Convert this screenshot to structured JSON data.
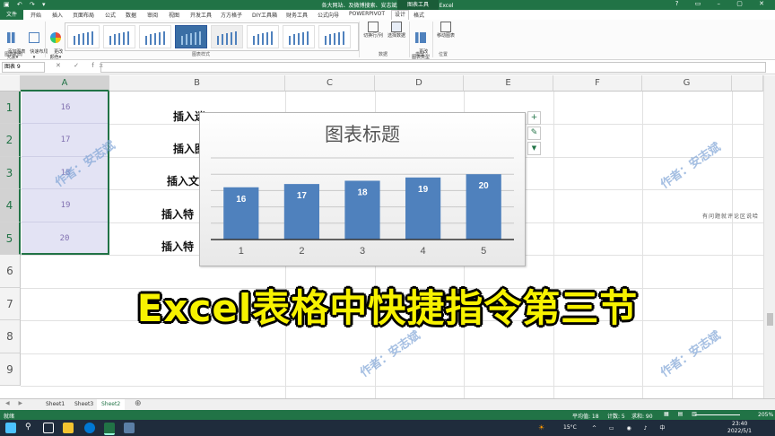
{
  "titlebar": {
    "title": "各大网站、及微博搜索、安志斌先生0018.xlsx - Excel",
    "context_tab": "图表工具"
  },
  "tabs": {
    "file": "文件",
    "items": [
      "开始",
      "插入",
      "页面布局",
      "公式",
      "数据",
      "审阅",
      "视图",
      "开发工具",
      "方方格子",
      "DIY工具箱",
      "财务工具",
      "公式向导",
      "POWERPIVOT",
      "设计",
      "格式"
    ]
  },
  "ribbon": {
    "add_element": "添加图表\n元素▾",
    "quick_layout": "快速布局\n▾",
    "change_colors": "更改\n颜色▾",
    "group_layout": "图表布局",
    "group_styles": "图表样式",
    "switch_row_col": "切换行/列",
    "select_data": "选择数据",
    "group_data": "数据",
    "change_type": "更改\n图表类型",
    "group_type": "类型",
    "move_chart": "移动图表",
    "group_location": "位置"
  },
  "formula_bar": {
    "name_box": "图表 9",
    "fx": "fx",
    "value": ""
  },
  "grid": {
    "columns": [
      "A",
      "B",
      "C",
      "D",
      "E",
      "F",
      "G"
    ],
    "rows": [
      "1",
      "2",
      "3",
      "4",
      "5",
      "6",
      "7",
      "8",
      "9"
    ],
    "col_a_values": [
      "16",
      "17",
      "18",
      "19",
      "20"
    ],
    "col_b_values": [
      "插入迷",
      "插入图",
      "插入文",
      "插入特",
      "插入特"
    ]
  },
  "chart_data": {
    "type": "bar",
    "title": "图表标题",
    "categories": [
      "1",
      "2",
      "3",
      "4",
      "5"
    ],
    "values": [
      16,
      17,
      18,
      19,
      20
    ],
    "ylim": [
      0,
      25
    ],
    "data_labels": [
      "16",
      "17",
      "18",
      "19",
      "20"
    ],
    "bar_color": "#4f81bd",
    "grid": true
  },
  "chart_buttons": {
    "elements": "+",
    "styles": "✎",
    "filter": "▼"
  },
  "watermarks": [
    "作者：安志斌",
    "作者：安志斌",
    "作者：安志斌",
    "作者：安志斌"
  ],
  "caption": "Excel表格中快捷指令第三节",
  "side_note": "有问题就评论区说哈",
  "sheets": [
    "Sheet1",
    "Sheet3",
    "Sheet2"
  ],
  "status": {
    "ready": "就绪",
    "average": "平均值: 18",
    "count": "计数: 5",
    "sum": "求和: 90",
    "zoom": "205%"
  },
  "taskbar": {
    "temperature": "15°C",
    "time": "23:40",
    "date": "2022/5/1"
  },
  "colors": {
    "excel_green": "#217346",
    "caption_yellow": "#f7f200",
    "bar": "#4f81bd"
  }
}
